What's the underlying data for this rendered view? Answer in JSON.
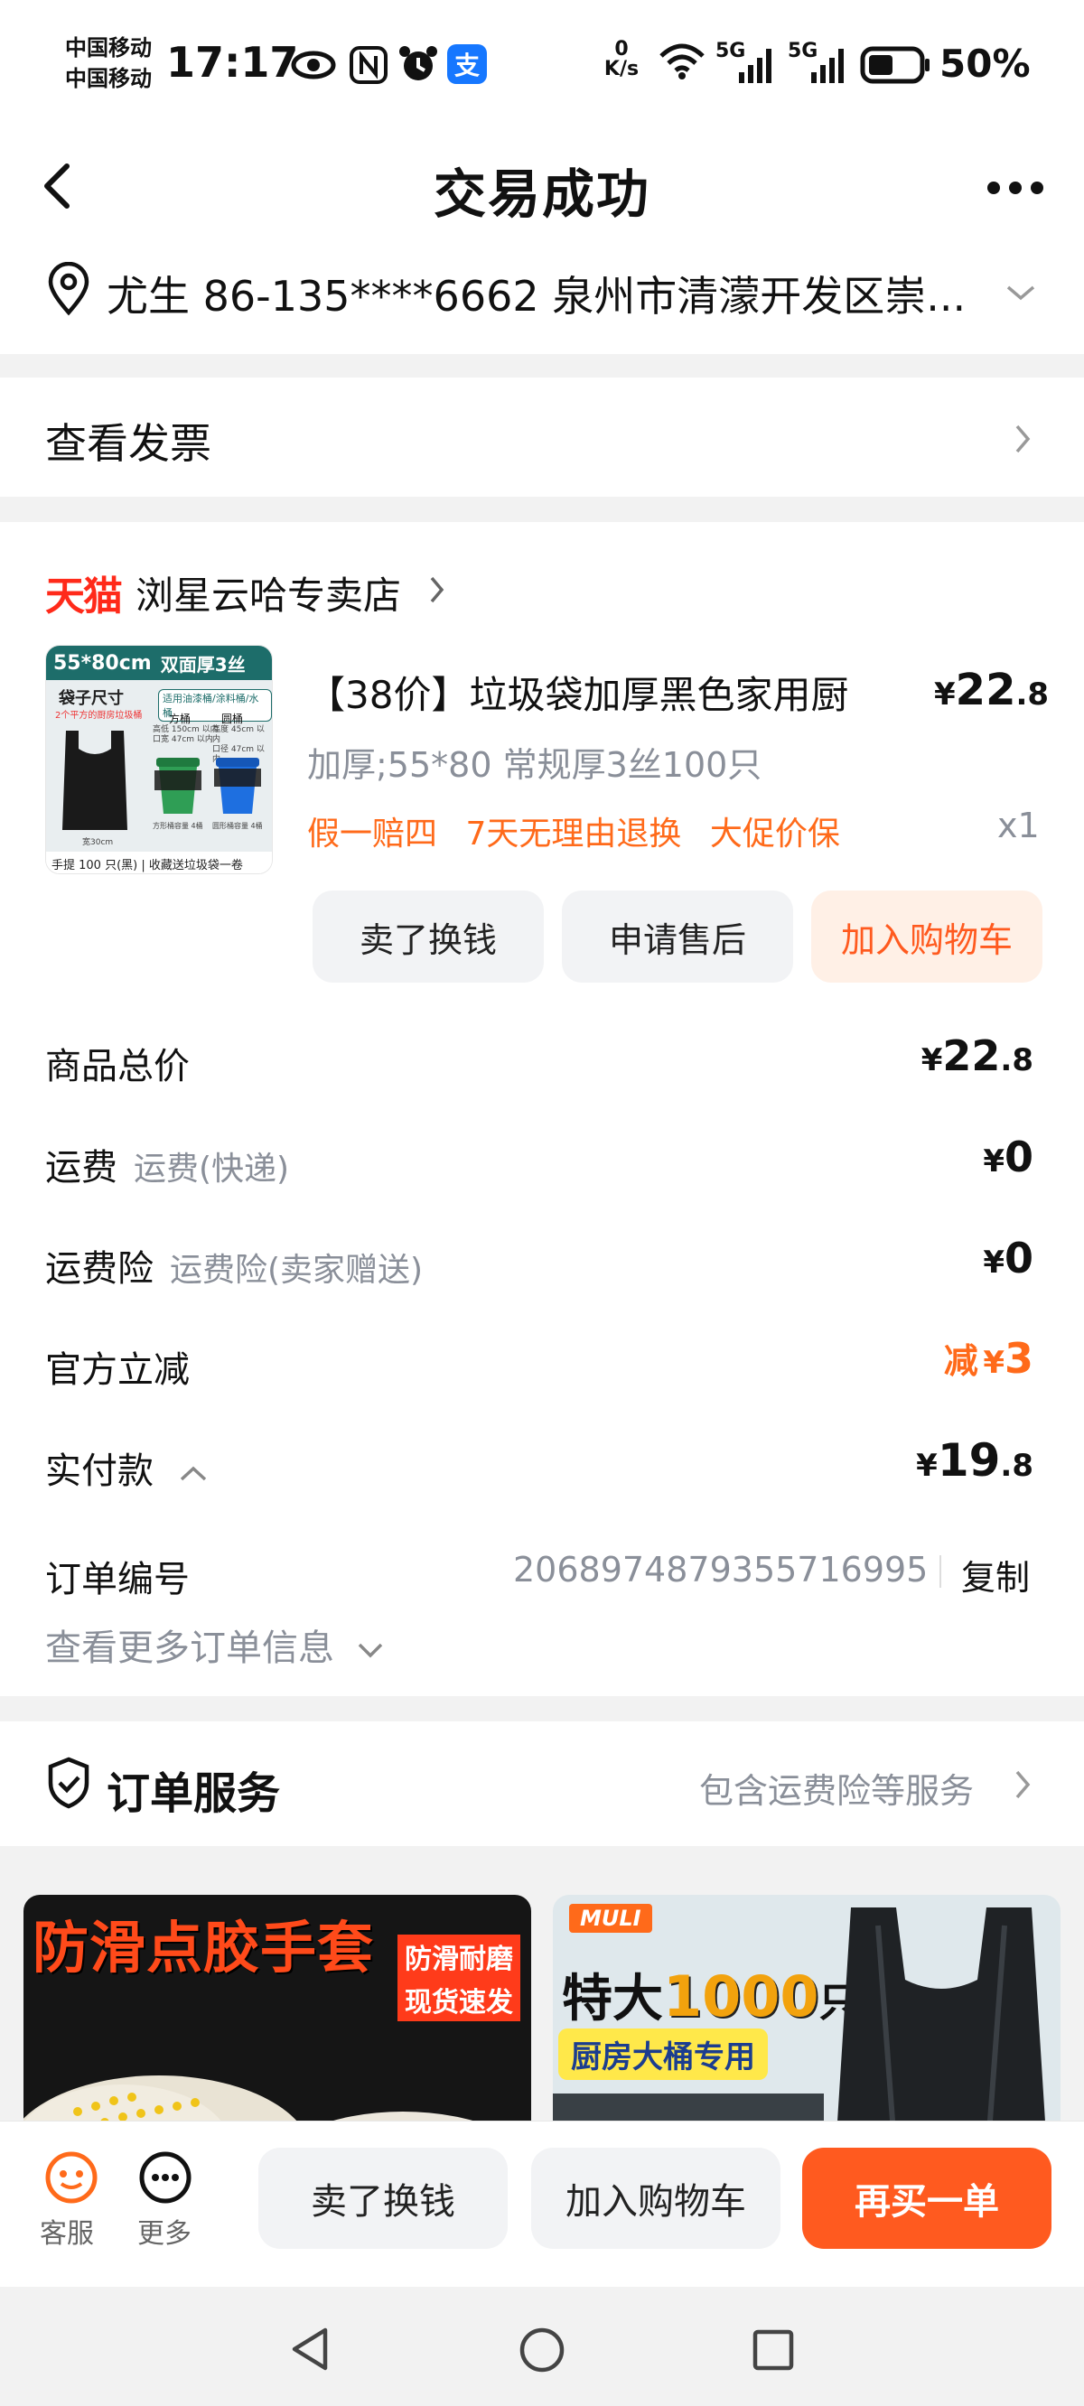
{
  "status_bar": {
    "carrier1": "中国移动",
    "carrier2": "中国移动",
    "time": "17:17",
    "net_speed_value": "0",
    "net_speed_unit": "K/s",
    "signal1_label": "5G",
    "signal2_label": "5G",
    "battery_text": "50%",
    "battery_level": 0.5
  },
  "header": {
    "title": "交易成功"
  },
  "address": {
    "text": "尤生  86-135****6662  泉州市清濛开发区崇..."
  },
  "invoice": {
    "label": "查看发票"
  },
  "store": {
    "logo_text": "天猫",
    "name": "浏星云哈专卖店"
  },
  "product": {
    "title": "【38价】垃圾袋加厚黑色家用厨",
    "spec": "加厚;55*80 常规厚3丝100只",
    "tags": [
      "假一赔四",
      "7天无理由退换",
      "大促价保"
    ],
    "price_symbol": "¥",
    "price_int": "22",
    "price_dec": ".8",
    "qty": "x1",
    "image": {
      "badge_size": "55*80cm",
      "badge_thick": "双面厚3丝",
      "heading": "袋子尺寸",
      "fine_print": "2个平方的厨房垃圾桶",
      "note": "适用油漆桶/涂料桶/水桶",
      "col1": "方桶",
      "col2": "圆桶",
      "col1_l1": "高低 150cm 以内",
      "col1_l2": "口宽 47cm 以内",
      "col2_l1": "高度 45cm 以内",
      "col2_l2": "口径 47cm 以内",
      "sub1": "方形桶容量 4桶",
      "sub2": "圆形桶容量 4桶",
      "dim_bottom": "宽30cm",
      "footer": "手提 100 只(黑) | 收藏送垃圾袋一卷"
    }
  },
  "product_buttons": {
    "sell": "卖了换钱",
    "after_sale": "申请售后",
    "add_cart": "加入购物车"
  },
  "summary": {
    "total_label": "商品总价",
    "total_int": "22",
    "total_dec": ".8",
    "shipping_label": "运费",
    "shipping_sub": "运费(快递)",
    "shipping_val": "0",
    "insurance_label": "运费险",
    "insurance_sub": "运费险(卖家赠送)",
    "insurance_val": "0",
    "discount_label": "官方立减",
    "discount_prefix": "减",
    "discount_val": "3",
    "paid_label": "实付款",
    "paid_int": "19",
    "paid_dec": ".8",
    "currency": "¥"
  },
  "order": {
    "number_label": "订单编号",
    "number": "2068974879355716995",
    "copy": "复制",
    "more": "查看更多订单信息"
  },
  "service": {
    "title": "订单服务",
    "desc": "包含运费险等服务"
  },
  "banners": {
    "left_title": "防滑点胶手套",
    "left_tag1": "防滑耐磨",
    "left_tag2": "现货速发",
    "right_brand": "MULI",
    "right_title_a": "特大",
    "right_title_num": "1000",
    "right_title_b": "只",
    "right_sub": "厨房大桶专用"
  },
  "bottom_bar": {
    "service": "客服",
    "more": "更多",
    "sell": "卖了换钱",
    "add_cart": "加入购物车",
    "rebuy": "再买一单"
  },
  "colors": {
    "accent": "#ff5a1f",
    "tag_orange": "#ff6a1a",
    "tmall_red": "#ff2a1a",
    "gray_text": "#8a8f99"
  }
}
